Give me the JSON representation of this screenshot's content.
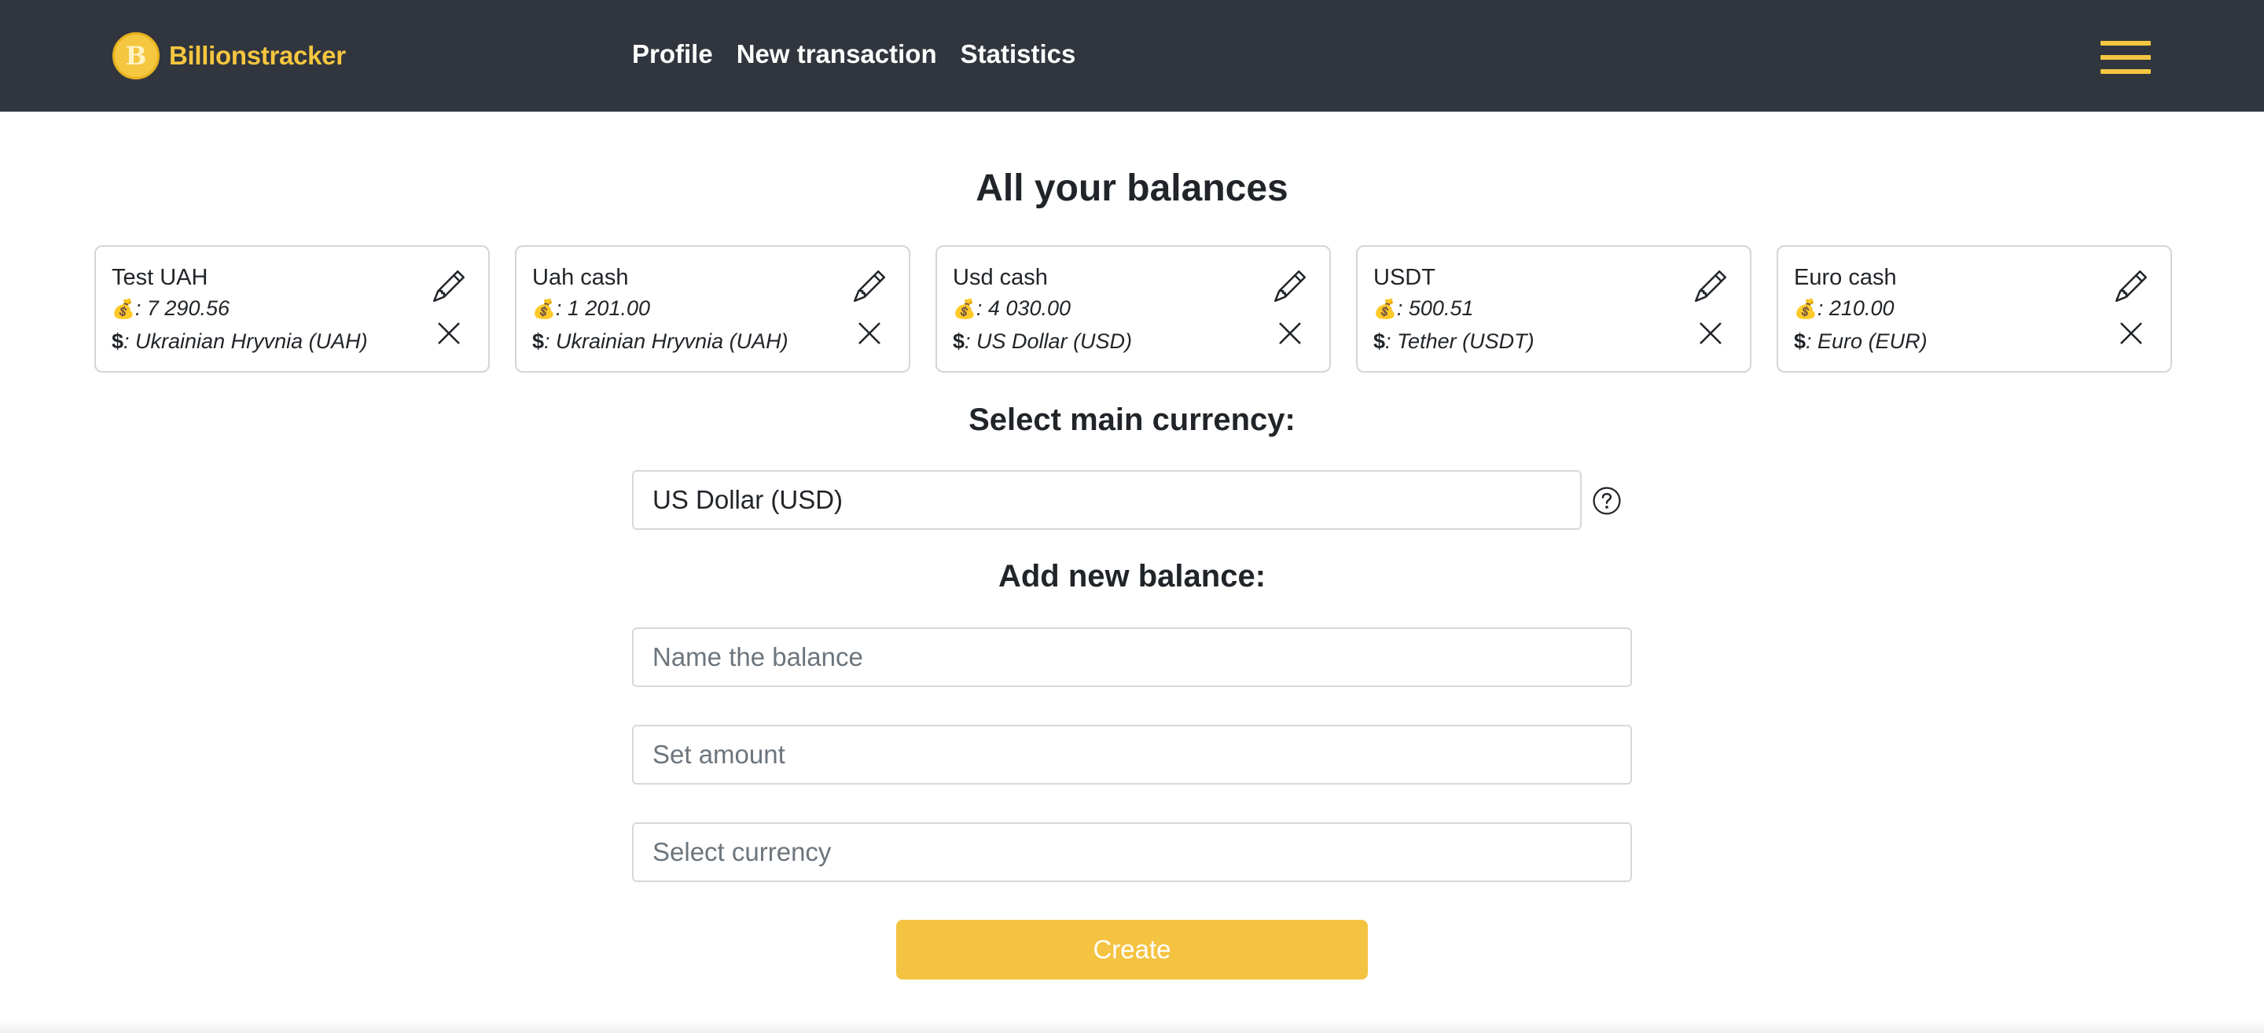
{
  "navbar": {
    "brand_letter": "B",
    "brand_name": "Billionstracker",
    "links": [
      "Profile",
      "New transaction",
      "Statistics"
    ],
    "menu_icon": "hamburger-menu-icon"
  },
  "balances_title": "All your balances",
  "balances": [
    {
      "name": "Test UAH",
      "amount": ": 7 290.56",
      "currency": ": Ukrainian Hryvnia (UAH)"
    },
    {
      "name": "Uah cash",
      "amount": ": 1 201.00",
      "currency": ": Ukrainian Hryvnia (UAH)"
    },
    {
      "name": "Usd cash",
      "amount": ": 4 030.00",
      "currency": ": US Dollar (USD)"
    },
    {
      "name": "USDT",
      "amount": ": 500.51",
      "currency": ": Tether (USDT)"
    },
    {
      "name": "Euro cash",
      "amount": ": 210.00",
      "currency": ": Euro (EUR)"
    }
  ],
  "glyphs": {
    "money_bag": "💰",
    "dollar": "$"
  },
  "main_currency": {
    "title": "Select main currency:",
    "selected": "US Dollar (USD)"
  },
  "add_balance": {
    "title": "Add new balance:",
    "name_placeholder": "Name the balance",
    "amount_placeholder": "Set amount",
    "currency_placeholder": "Select currency",
    "create_label": "Create"
  },
  "colors": {
    "navbar_bg": "#31353d",
    "accent": "#f5c342",
    "brand": "#f5c63f"
  }
}
